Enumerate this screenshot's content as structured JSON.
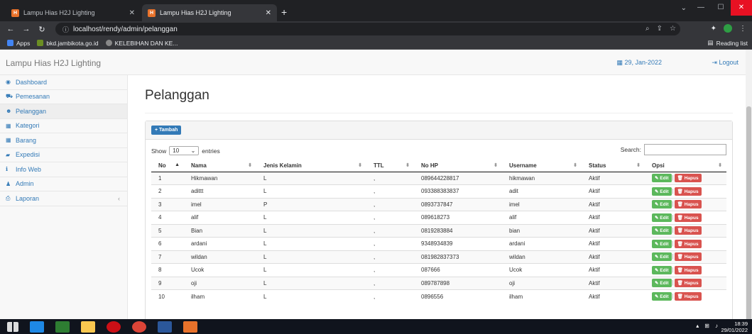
{
  "browser": {
    "tabs": [
      {
        "title": "Lampu Hias H2J Lighting"
      },
      {
        "title": "Lampu Hias H2J Lighting"
      }
    ],
    "url": "localhost/rendy/admin/pelanggan",
    "bookmarks": [
      "Apps",
      "bkd.jambikota.go.id",
      "KELEBIHAN DAN KE..."
    ],
    "reading_list": "Reading list"
  },
  "app": {
    "brand": "Lampu Hias H2J Lighting",
    "date": "29, Jan-2022",
    "logout": "Logout"
  },
  "sidebar": {
    "items": [
      {
        "label": "Dashboard",
        "icon": "dashboard-icon"
      },
      {
        "label": "Pemesanan",
        "icon": "cart-icon"
      },
      {
        "label": "Pelanggan",
        "icon": "users-icon"
      },
      {
        "label": "Kategori",
        "icon": "table-icon"
      },
      {
        "label": "Barang",
        "icon": "table-icon"
      },
      {
        "label": "Expedisi",
        "icon": "truck-icon"
      },
      {
        "label": "Info Web",
        "icon": "info-icon"
      },
      {
        "label": "Admin",
        "icon": "user-icon"
      },
      {
        "label": "Laporan",
        "icon": "print-icon"
      }
    ]
  },
  "main": {
    "title": "Pelanggan",
    "add_button": "Tambah",
    "show_label": "Show",
    "entries_value": "10",
    "entries_label": "entries",
    "search_label": "Search:",
    "columns": [
      "No",
      "Nama",
      "Jenis Kelamin",
      "TTL",
      "No HP",
      "Username",
      "Status",
      "Opsi"
    ],
    "edit_label": "Edit",
    "delete_label": "Hapus",
    "rows": [
      {
        "no": "1",
        "nama": "Hikmawan",
        "jk": "L",
        "ttl": ",",
        "hp": "089644228817",
        "username": "hikmawan",
        "status": "Aktif"
      },
      {
        "no": "2",
        "nama": "adittt",
        "jk": "L",
        "ttl": ",",
        "hp": "093388383837",
        "username": "adit",
        "status": "Aktif"
      },
      {
        "no": "3",
        "nama": "imel",
        "jk": "P",
        "ttl": ",",
        "hp": "0893737847",
        "username": "imel",
        "status": "Aktif"
      },
      {
        "no": "4",
        "nama": "alif",
        "jk": "L",
        "ttl": ",",
        "hp": "089618273",
        "username": "alif",
        "status": "Aktif"
      },
      {
        "no": "5",
        "nama": "Bian",
        "jk": "L",
        "ttl": ",",
        "hp": "0819283884",
        "username": "bian",
        "status": "Aktif"
      },
      {
        "no": "6",
        "nama": "ardani",
        "jk": "L",
        "ttl": ",",
        "hp": "9348934839",
        "username": "ardani",
        "status": "Aktif"
      },
      {
        "no": "7",
        "nama": "wildan",
        "jk": "L",
        "ttl": ",",
        "hp": "081982837373",
        "username": "wildan",
        "status": "Aktif"
      },
      {
        "no": "8",
        "nama": "Ucok",
        "jk": "L",
        "ttl": ",",
        "hp": "087666",
        "username": "Ucok",
        "status": "Aktif"
      },
      {
        "no": "9",
        "nama": "oji",
        "jk": "L",
        "ttl": ",",
        "hp": "089787898",
        "username": "oji",
        "status": "Aktif"
      },
      {
        "no": "10",
        "nama": "ilham",
        "jk": "L",
        "ttl": ",",
        "hp": "0896556",
        "username": "ilham",
        "status": "Aktif"
      }
    ]
  },
  "taskbar": {
    "time": "18:39",
    "date": "29/01/2022"
  },
  "colors": {
    "primary": "#337ab7",
    "edit": "#5cb85c",
    "delete": "#d9534f"
  }
}
